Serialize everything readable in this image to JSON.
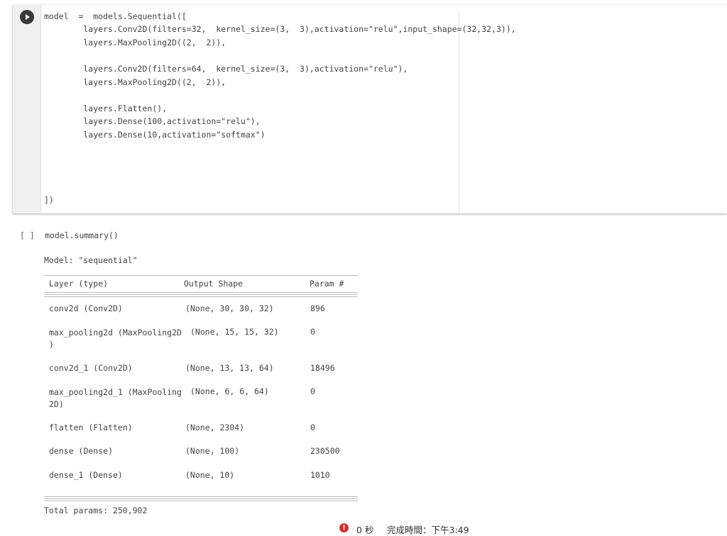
{
  "cell1": {
    "lines": [
      "model  =  models.Sequential([",
      "        layers.Conv2D(filters=32,  kernel_size=(3,  3),activation=\"relu\",input_shape=(32,32,3)),",
      "        layers.MaxPooling2D((2,  2)),",
      "",
      "        layers.Conv2D(filters=64,  kernel_size=(3,  3),activation=\"relu\"),",
      "        layers.MaxPooling2D((2,  2)),",
      "",
      "        layers.Flatten(),",
      "        layers.Dense(100,activation=\"relu\"),",
      "        layers.Dense(10,activation=\"softmax\")",
      "",
      "",
      "",
      "",
      "])"
    ]
  },
  "cell2": {
    "bracket": "[ ]",
    "code": "model.summary()"
  },
  "output": {
    "model_label": "Model: \"sequential\"",
    "headers": [
      "Layer (type)",
      "Output Shape",
      "Param #"
    ],
    "rows": [
      {
        "layer": "conv2d (Conv2D)",
        "shape": "(None, 30, 30, 32)",
        "params": "896"
      },
      {
        "layer": "max_pooling2d (MaxPooling2D\n)",
        "shape": "(None, 15, 15, 32)",
        "params": "0"
      },
      {
        "layer": "conv2d_1 (Conv2D)",
        "shape": "(None, 13, 13, 64)",
        "params": "18496"
      },
      {
        "layer": "max_pooling2d_1 (MaxPooling\n2D)",
        "shape": "(None, 6, 6, 64)",
        "params": "0"
      },
      {
        "layer": "flatten (Flatten)",
        "shape": "(None, 2304)",
        "params": "0"
      },
      {
        "layer": "dense (Dense)",
        "shape": "(None, 100)",
        "params": "230500"
      },
      {
        "layer": "dense_1 (Dense)",
        "shape": "(None, 10)",
        "params": "1010"
      }
    ],
    "total_params": "Total params: 250,902"
  },
  "status": {
    "icon": "error-icon",
    "time": "0 秒",
    "completed": "完成時間：下午3:49"
  },
  "colors": {
    "keyword": "#3a6ba5",
    "string": "#b22222",
    "number": "#0a8a5a",
    "error": "#d32f2f"
  }
}
